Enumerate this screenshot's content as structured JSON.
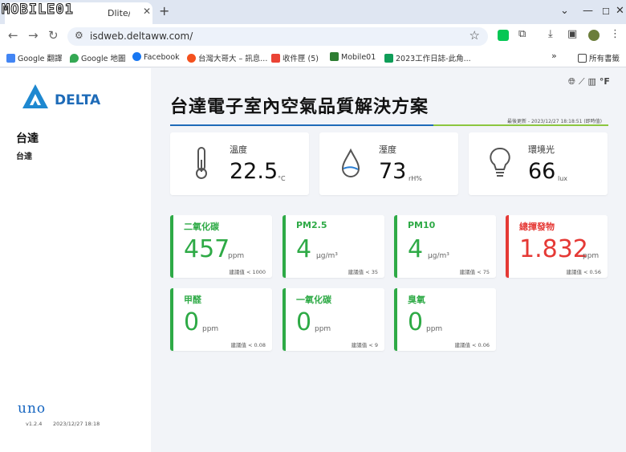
{
  "browser": {
    "watermark": "MOBILE01",
    "tab_title": "Dlite/\\",
    "url": "isdweb.deltaww.com/",
    "bookmarks": [
      "Google 翻譯",
      "Google 地圖",
      "Facebook",
      "台灣大哥大 – 訊息...",
      "收件匣 (5)",
      "Mobile01",
      "2023工作日誌-此角..."
    ],
    "bookmarks_folder": "所有書籤"
  },
  "sidebar": {
    "brand": "DELTA",
    "site_name": "台達",
    "site_sub": "台達",
    "product": "uno",
    "version": "v1.2.4",
    "updated": "2023/12/27 18:18"
  },
  "main": {
    "title": "台達電子室內空氣品質解決方案",
    "last_update": "最後更新 - 2023/12/27 18:18:51 (即時值)",
    "unit_toggle": "°F",
    "environment": [
      {
        "label": "溫度",
        "value": "22.5",
        "unit": "°C",
        "icon": "thermometer-icon"
      },
      {
        "label": "溼度",
        "value": "73",
        "unit": "rH%",
        "icon": "water-drop-icon"
      },
      {
        "label": "環境光",
        "value": "66",
        "unit": "lux",
        "icon": "light-bulb-icon"
      }
    ],
    "air_quality": [
      {
        "label": "二氧化碳",
        "value": "457",
        "unit": "ppm",
        "ref": "建議值 < 1000",
        "status": "good"
      },
      {
        "label": "PM2.5",
        "value": "4",
        "unit": "μg/m³",
        "ref": "建議值 < 35",
        "status": "good"
      },
      {
        "label": "PM10",
        "value": "4",
        "unit": "μg/m³",
        "ref": "建議值 < 75",
        "status": "good"
      },
      {
        "label": "總揮發物",
        "value": "1.832",
        "unit": "ppm",
        "ref": "建議值 < 0.56",
        "status": "alert"
      },
      {
        "label": "甲醛",
        "value": "0",
        "unit": "ppm",
        "ref": "建議值 < 0.08",
        "status": "good"
      },
      {
        "label": "一氧化碳",
        "value": "0",
        "unit": "ppm",
        "ref": "建議值 < 9",
        "status": "good"
      },
      {
        "label": "臭氧",
        "value": "0",
        "unit": "ppm",
        "ref": "建議值 < 0.06",
        "status": "good"
      }
    ]
  },
  "colors": {
    "good": "#2eaa46",
    "alert": "#e53935",
    "brand": "#1e6bb8",
    "accent": "#8cc63f"
  }
}
